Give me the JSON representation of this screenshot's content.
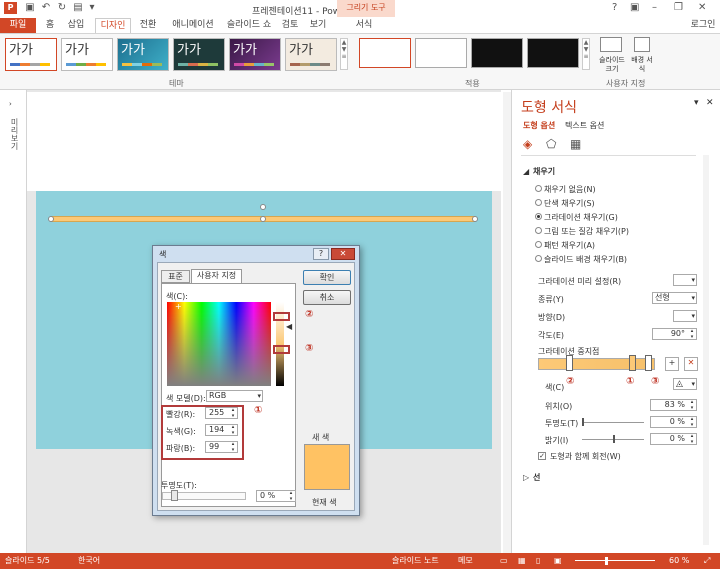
{
  "window": {
    "title": "프레젠테이션11 - PowerPoint",
    "context_tab_title": "그리기 도구",
    "user": "로그인",
    "brand_color": "#d24726"
  },
  "tabs": {
    "file": "파일",
    "home": "홈",
    "insert": "삽입",
    "design": "디자인",
    "transitions": "전환",
    "animations": "애니메이션",
    "slideshow": "슬라이드 쇼",
    "review": "검토",
    "view": "보기",
    "format": "서식"
  },
  "ribbon": {
    "themes_label": "테마",
    "variants_label": "적용",
    "customize_label": "사용자 지정",
    "theme_sample": "가가",
    "slide_size": "슬라이드 크기",
    "format_bg": "배경 서식"
  },
  "left_panel": {
    "label": "미리보기"
  },
  "pane": {
    "title": "도형 서식",
    "tab_shape": "도형 옵션",
    "tab_text": "텍스트 옵션",
    "fill_header": "채우기",
    "fill_options": [
      "채우기 없음(N)",
      "단색 채우기(S)",
      "그라데이션 채우기(G)",
      "그림 또는 질감 채우기(P)",
      "패턴 채우기(A)",
      "슬라이드 배경 채우기(B)"
    ],
    "preset_label": "그라데이션 미리 설정(R)",
    "type_label": "종류(Y)",
    "type_value": "선형",
    "direction_label": "방향(D)",
    "angle_label": "각도(E)",
    "angle_value": "90°",
    "stops_label": "그라데이션 중지점",
    "color_label": "색(C)",
    "position_label": "위치(O)",
    "position_value": "83 %",
    "transparency_label": "투명도(T)",
    "transparency_value": "0 %",
    "brightness_label": "밝기(I)",
    "brightness_value": "0 %",
    "rotate_label": "도형과 함께 회전(W)",
    "line_header": "선"
  },
  "dialog": {
    "title": "색",
    "tab_standard": "표준",
    "tab_custom": "사용자 지정",
    "ok": "확인",
    "cancel": "취소",
    "colors_label": "색(C):",
    "model_label": "색 모델(D):",
    "model_value": "RGB",
    "red_label": "빨강(R):",
    "red_value": "255",
    "green_label": "녹색(G):",
    "green_value": "194",
    "blue_label": "파랑(B):",
    "blue_value": "99",
    "transparency_label": "투명도(T):",
    "transparency_value": "0 %",
    "new_label": "새 색",
    "current_label": "현재 색"
  },
  "markers": {
    "one": "①",
    "two": "②",
    "three": "③"
  },
  "status": {
    "slide": "슬라이드 5/5",
    "language": "한국어",
    "notes": "슬라이드 노트",
    "memo": "메모",
    "zoom": "60 %"
  }
}
